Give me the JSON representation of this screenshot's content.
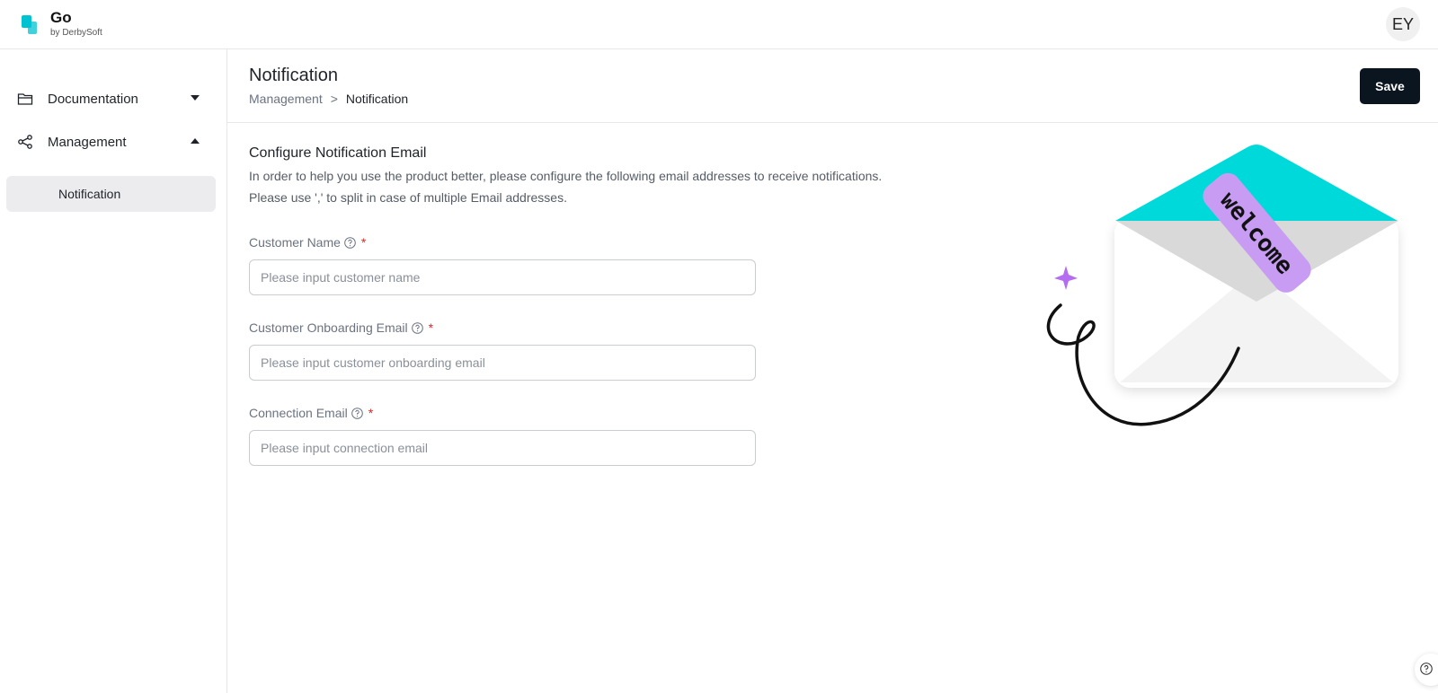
{
  "app": {
    "name": "Go",
    "subtitle": "by DerbySoft",
    "avatar_initials": "EY"
  },
  "sidebar": {
    "items": [
      {
        "label": "Documentation",
        "icon": "folder-icon",
        "expanded": false
      },
      {
        "label": "Management",
        "icon": "share-icon",
        "expanded": true
      }
    ],
    "sub_items": [
      {
        "label": "Notification",
        "active": true
      }
    ]
  },
  "page": {
    "title": "Notification",
    "breadcrumb": {
      "parent": "Management",
      "separator": ">",
      "current": "Notification"
    },
    "save_label": "Save"
  },
  "form": {
    "section_title": "Configure Notification Email",
    "description_line1": "In order to help you use the product better, please configure the following email addresses to receive notifications.",
    "description_line2": "Please use ',' to split in case of multiple Email addresses.",
    "fields": [
      {
        "label": "Customer Name",
        "required_mark": "*",
        "placeholder": "Please input customer name",
        "value": ""
      },
      {
        "label": "Customer Onboarding Email",
        "required_mark": "*",
        "placeholder": "Please input customer onboarding email",
        "value": ""
      },
      {
        "label": "Connection Email",
        "required_mark": "*",
        "placeholder": "Please input connection email",
        "value": ""
      }
    ]
  },
  "illustration": {
    "ribbon_text": "welcome",
    "colors": {
      "envelope_flap": "#00d9d9",
      "ribbon": "#c79cf2",
      "sparkle": "#b46cf0"
    }
  },
  "colors": {
    "accent": "#00c2d1",
    "primary_button": "#0b1520",
    "required": "#e02424",
    "active_nav_bg": "#ececee"
  }
}
